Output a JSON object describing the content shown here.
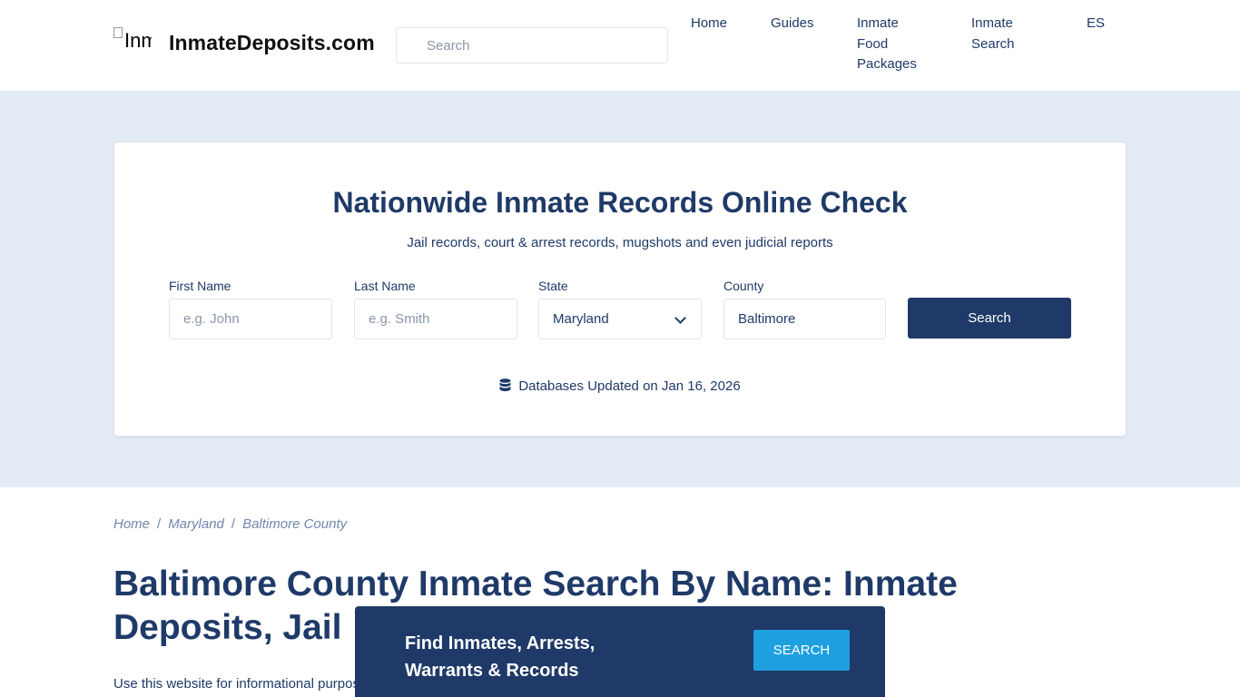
{
  "header": {
    "logo_alt": "Inmate",
    "site_name": "InmateDeposits.com",
    "search_placeholder": "Search",
    "nav": [
      {
        "label": "Home"
      },
      {
        "label": "Guides"
      },
      {
        "label": "Inmate Food Packages"
      },
      {
        "label": "Inmate Search"
      },
      {
        "label": "ES"
      }
    ]
  },
  "hero": {
    "title": "Nationwide Inmate Records Online Check",
    "subtitle": "Jail records, court & arrest records, mugshots and even judicial reports",
    "fields": {
      "first_name": {
        "label": "First Name",
        "placeholder": "e.g. John"
      },
      "last_name": {
        "label": "Last Name",
        "placeholder": "e.g. Smith"
      },
      "state": {
        "label": "State",
        "value": "Maryland"
      },
      "county": {
        "label": "County",
        "value": "Baltimore"
      }
    },
    "search_button": "Search",
    "db_updated": "Databases Updated on Jan 16, 2026"
  },
  "breadcrumb": [
    "Home",
    "Maryland",
    "Baltimore County"
  ],
  "page_title": "Baltimore County Inmate Search By Name: Inmate Deposits, Jail",
  "intro_text": "Use this website for informational purpos",
  "banner": {
    "text_line1": "Find Inmates, Arrests,",
    "text_line2": "Warrants & Records",
    "button": "SEARCH"
  },
  "colors": {
    "primary": "#1f3a68",
    "hero_bg": "#e3ebf7",
    "accent": "#1ea0e0"
  }
}
